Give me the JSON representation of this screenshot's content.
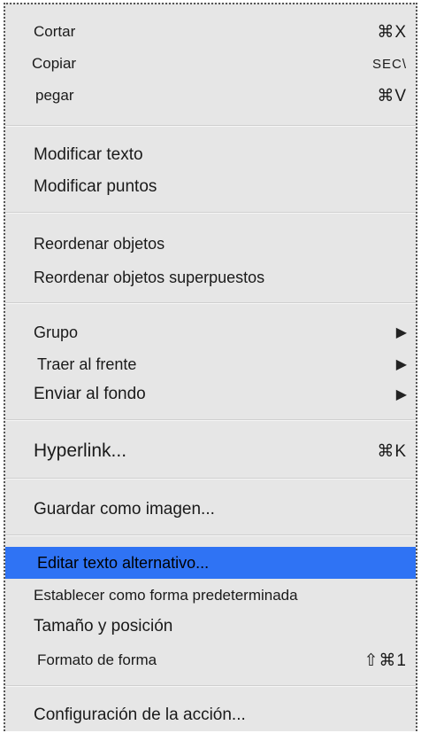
{
  "menu": {
    "items": [
      {
        "label": "Cortar",
        "shortcut": "⌘X"
      },
      {
        "label": "Copiar",
        "shortcut": "SEC\\"
      },
      {
        "label": "pegar",
        "shortcut": "⌘V"
      },
      {
        "label": "Modificar texto"
      },
      {
        "label": "Modificar puntos"
      },
      {
        "label": "Reordenar objetos"
      },
      {
        "label": "Reordenar objetos superpuestos"
      },
      {
        "label": "Grupo",
        "submenu": "▶"
      },
      {
        "label": "Traer al frente",
        "submenu": "▶"
      },
      {
        "label": "Enviar al fondo",
        "submenu": "▶"
      },
      {
        "label": "Hyperlink...",
        "shortcut": "⌘K"
      },
      {
        "label": "Guardar como imagen..."
      },
      {
        "label": "Editar texto alternativo..."
      },
      {
        "label": "Establecer como forma predeterminada"
      },
      {
        "label": "Tamaño y posición"
      },
      {
        "label": "Formato de forma",
        "shortcut": "⇧⌘1"
      },
      {
        "label": "Configuración de la acción..."
      }
    ]
  },
  "colors": {
    "menu_background": "#e6e6e6",
    "highlight": "#2f73f4"
  }
}
